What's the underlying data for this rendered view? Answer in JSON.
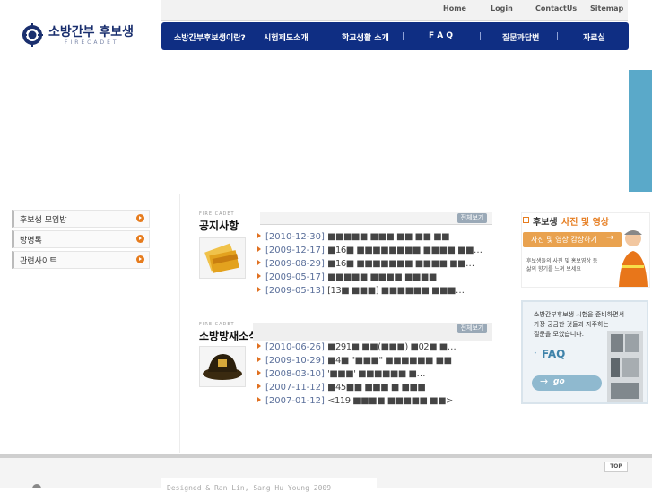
{
  "logo": {
    "title_ko": "소방간부 후보생",
    "title_en": "FIRECADET"
  },
  "toplinks": [
    "Home",
    "Login",
    "ContactUs",
    "Sitemap"
  ],
  "gnb": [
    "소방간부후보생이란?",
    "시험제도소개",
    "학교생활 소개",
    "F A Q",
    "질문과답변",
    "자료실"
  ],
  "left_menu": [
    "후보생 모임방",
    "방명록",
    "관련사이트"
  ],
  "notice": {
    "small": "FIRE CADET",
    "title": "공지사항",
    "more": "전체보기",
    "items": [
      {
        "date": "[2010-12-30]",
        "title": "■■■■■ ■■■ ■■ ■■ ■■"
      },
      {
        "date": "[2009-12-17]",
        "title": "■16■ ■■■■■■■■ ■■■■ ■■…"
      },
      {
        "date": "[2009-08-29]",
        "title": "■16■ ■■■■■■■ ■■■■ ■■…"
      },
      {
        "date": "[2009-05-17]",
        "title": "■■■■■ ■■■■ ■■■■"
      },
      {
        "date": "[2009-05-13]",
        "title": "[13■ ■■■] ■■■■■■ ■■■…"
      }
    ]
  },
  "disaster": {
    "small": "FIRE CADET",
    "title": "소방방재소식",
    "more": "전체보기",
    "items": [
      {
        "date": "[2010-06-26]",
        "title": "■291■ ■■(■■■) ■02■ ■…"
      },
      {
        "date": "[2009-10-29]",
        "title": "■4■ \"■■■\" ■■■■■■ ■■"
      },
      {
        "date": "[2008-03-10]",
        "title": "'■■■' ■■■■■■ ■…"
      },
      {
        "date": "[2007-11-12]",
        "title": "■45■■ ■■■ ■ ■■■"
      },
      {
        "date": "[2007-01-12]",
        "title": "<119 ■■■■ ■■■■■ ■■>"
      }
    ]
  },
  "banner1": {
    "title_a": "후보생",
    "title_b": "사진 및 영상",
    "button": "사진 및 영상 감상하기",
    "desc1": "후보생들의 사진 및 홍보영상 등",
    "desc2": "삶의 향기를 느껴 보세요"
  },
  "banner2": {
    "desc1": "소방간부후보생 시험을 준비하면서",
    "desc2": "가장 궁금한 것들과 자주하는",
    "desc3": "질문을 모았습니다.",
    "faq": "FAQ",
    "go": "go"
  },
  "footer": {
    "top": "TOP",
    "copyright": "Designed & Ran Lin, Sang Hu Young 2009"
  },
  "colors": {
    "navy": "#0f2e83",
    "orange": "#e67c1e",
    "teal": "#5aa9c9"
  }
}
